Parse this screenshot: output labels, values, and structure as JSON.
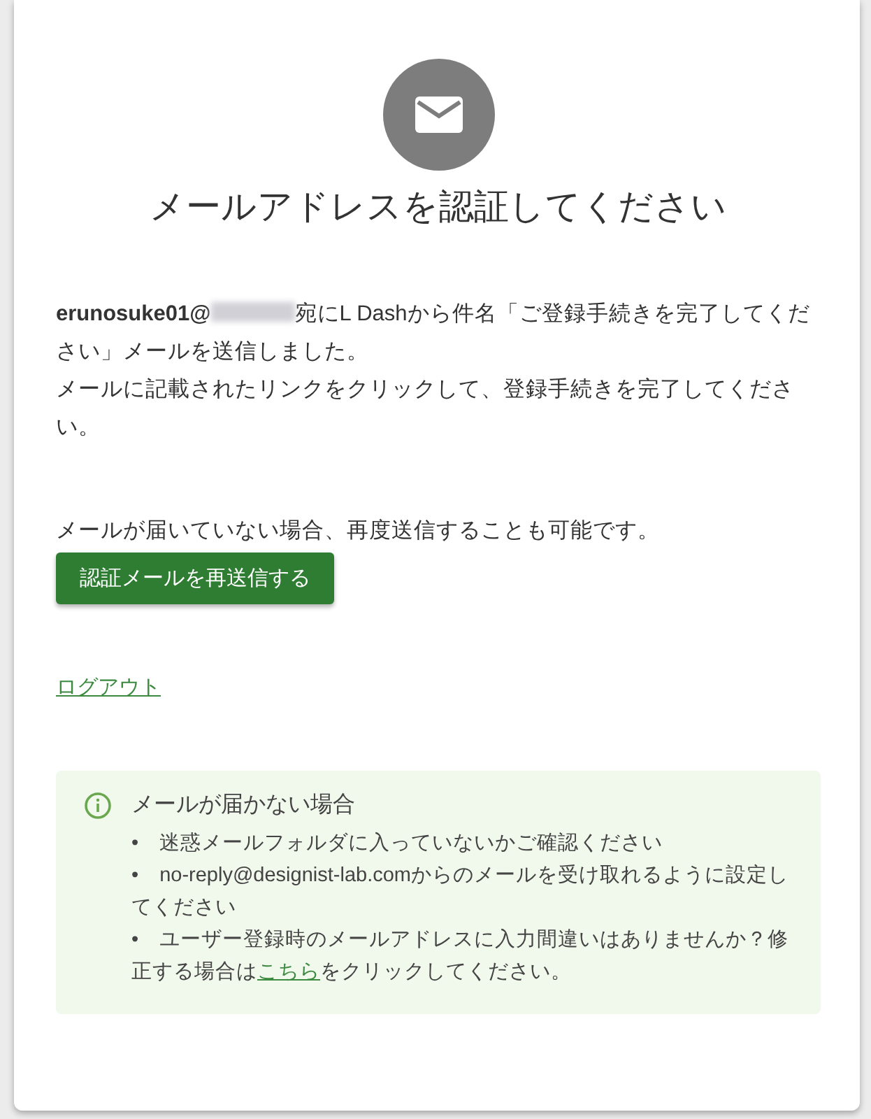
{
  "title": "メールアドレスを認証してください",
  "sent_message": {
    "email": "erunosuke01@",
    "text": "宛にL Dashから件名「ご登録手続きを完了してください」メールを送信しました。"
  },
  "instruction": "メールに記載されたリンクをクリックして、登録手続きを完了してください。",
  "resend_note": "メールが届いていない場合、再度送信することも可能です。",
  "resend_button": "認証メールを再送信する",
  "logout_link": "ログアウト",
  "help": {
    "title": "メールが届かない場合",
    "items": [
      {
        "text": "•　迷惑メールフォルダに入っていないかご確認ください"
      },
      {
        "text": "•　no-reply@designist-lab.comからのメールを受け取れるように設定してください"
      },
      {
        "text": "•　ユーザー登録時のメールアドレスに入力間違いはありませんか？修正する場合は",
        "link": "こちら",
        "after": "をクリックしてください。"
      }
    ]
  }
}
